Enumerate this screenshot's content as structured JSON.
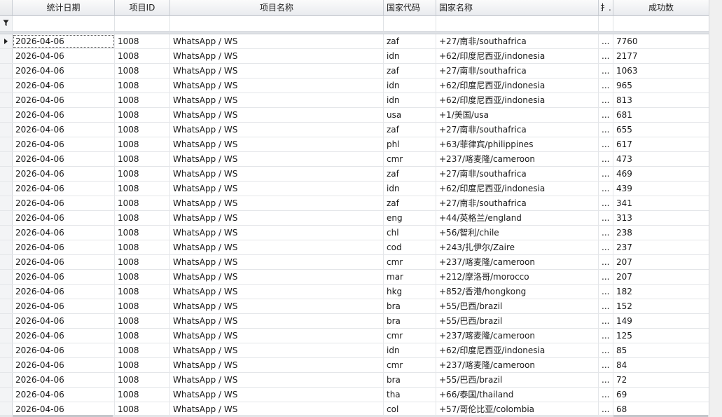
{
  "columns": {
    "date": "统计日期",
    "project_id": "项目ID",
    "project_name": "项目名称",
    "country_code": "国家代码",
    "country_name": "国家名称",
    "truncated": "扌.",
    "success_count": "成功数"
  },
  "icons": {
    "filter": "funnel-filter-icon",
    "row_indicator": "current-row-arrow-icon"
  },
  "rows": [
    {
      "date": "2026-04-06",
      "project_id": "1008",
      "project_name": "WhatsApp / WS",
      "country_code": "zaf",
      "country_name": "+27/南非/southafrica",
      "truncated": "...",
      "success_count": "7760"
    },
    {
      "date": "2026-04-06",
      "project_id": "1008",
      "project_name": "WhatsApp / WS",
      "country_code": "idn",
      "country_name": "+62/印度尼西亚/indonesia",
      "truncated": "...",
      "success_count": "2177"
    },
    {
      "date": "2026-04-06",
      "project_id": "1008",
      "project_name": "WhatsApp / WS",
      "country_code": "zaf",
      "country_name": "+27/南非/southafrica",
      "truncated": "...",
      "success_count": "1063"
    },
    {
      "date": "2026-04-06",
      "project_id": "1008",
      "project_name": "WhatsApp / WS",
      "country_code": "idn",
      "country_name": "+62/印度尼西亚/indonesia",
      "truncated": "...",
      "success_count": "965"
    },
    {
      "date": "2026-04-06",
      "project_id": "1008",
      "project_name": "WhatsApp / WS",
      "country_code": "idn",
      "country_name": "+62/印度尼西亚/indonesia",
      "truncated": "...",
      "success_count": "813"
    },
    {
      "date": "2026-04-06",
      "project_id": "1008",
      "project_name": "WhatsApp / WS",
      "country_code": "usa",
      "country_name": "+1/美国/usa",
      "truncated": "...",
      "success_count": "681"
    },
    {
      "date": "2026-04-06",
      "project_id": "1008",
      "project_name": "WhatsApp / WS",
      "country_code": "zaf",
      "country_name": "+27/南非/southafrica",
      "truncated": "...",
      "success_count": "655"
    },
    {
      "date": "2026-04-06",
      "project_id": "1008",
      "project_name": "WhatsApp / WS",
      "country_code": "phl",
      "country_name": "+63/菲律宾/philippines",
      "truncated": "...",
      "success_count": "617"
    },
    {
      "date": "2026-04-06",
      "project_id": "1008",
      "project_name": "WhatsApp / WS",
      "country_code": "cmr",
      "country_name": "+237/喀麦隆/cameroon",
      "truncated": "...",
      "success_count": "473"
    },
    {
      "date": "2026-04-06",
      "project_id": "1008",
      "project_name": "WhatsApp / WS",
      "country_code": "zaf",
      "country_name": "+27/南非/southafrica",
      "truncated": "...",
      "success_count": "469"
    },
    {
      "date": "2026-04-06",
      "project_id": "1008",
      "project_name": "WhatsApp / WS",
      "country_code": "idn",
      "country_name": "+62/印度尼西亚/indonesia",
      "truncated": "...",
      "success_count": "439"
    },
    {
      "date": "2026-04-06",
      "project_id": "1008",
      "project_name": "WhatsApp / WS",
      "country_code": "zaf",
      "country_name": "+27/南非/southafrica",
      "truncated": "...",
      "success_count": "341"
    },
    {
      "date": "2026-04-06",
      "project_id": "1008",
      "project_name": "WhatsApp / WS",
      "country_code": "eng",
      "country_name": "+44/英格兰/england",
      "truncated": "...",
      "success_count": "313"
    },
    {
      "date": "2026-04-06",
      "project_id": "1008",
      "project_name": "WhatsApp / WS",
      "country_code": "chl",
      "country_name": "+56/智利/chile",
      "truncated": "...",
      "success_count": "238"
    },
    {
      "date": "2026-04-06",
      "project_id": "1008",
      "project_name": "WhatsApp / WS",
      "country_code": "cod",
      "country_name": "+243/扎伊尔/Zaire",
      "truncated": "...",
      "success_count": "237"
    },
    {
      "date": "2026-04-06",
      "project_id": "1008",
      "project_name": "WhatsApp / WS",
      "country_code": "cmr",
      "country_name": "+237/喀麦隆/cameroon",
      "truncated": "...",
      "success_count": "207"
    },
    {
      "date": "2026-04-06",
      "project_id": "1008",
      "project_name": "WhatsApp / WS",
      "country_code": "mar",
      "country_name": "+212/摩洛哥/morocco",
      "truncated": "...",
      "success_count": "207"
    },
    {
      "date": "2026-04-06",
      "project_id": "1008",
      "project_name": "WhatsApp / WS",
      "country_code": "hkg",
      "country_name": "+852/香港/hongkong",
      "truncated": "...",
      "success_count": "182"
    },
    {
      "date": "2026-04-06",
      "project_id": "1008",
      "project_name": "WhatsApp / WS",
      "country_code": "bra",
      "country_name": "+55/巴西/brazil",
      "truncated": "...",
      "success_count": "152"
    },
    {
      "date": "2026-04-06",
      "project_id": "1008",
      "project_name": "WhatsApp / WS",
      "country_code": "bra",
      "country_name": "+55/巴西/brazil",
      "truncated": "...",
      "success_count": "149"
    },
    {
      "date": "2026-04-06",
      "project_id": "1008",
      "project_name": "WhatsApp / WS",
      "country_code": "cmr",
      "country_name": "+237/喀麦隆/cameroon",
      "truncated": "...",
      "success_count": "125"
    },
    {
      "date": "2026-04-06",
      "project_id": "1008",
      "project_name": "WhatsApp / WS",
      "country_code": "idn",
      "country_name": "+62/印度尼西亚/indonesia",
      "truncated": "...",
      "success_count": "85"
    },
    {
      "date": "2026-04-06",
      "project_id": "1008",
      "project_name": "WhatsApp / WS",
      "country_code": "cmr",
      "country_name": "+237/喀麦隆/cameroon",
      "truncated": "...",
      "success_count": "84"
    },
    {
      "date": "2026-04-06",
      "project_id": "1008",
      "project_name": "WhatsApp / WS",
      "country_code": "bra",
      "country_name": "+55/巴西/brazil",
      "truncated": "...",
      "success_count": "72"
    },
    {
      "date": "2026-04-06",
      "project_id": "1008",
      "project_name": "WhatsApp / WS",
      "country_code": "tha",
      "country_name": "+66/泰国/thailand",
      "truncated": "...",
      "success_count": "69"
    },
    {
      "date": "2026-04-06",
      "project_id": "1008",
      "project_name": "WhatsApp / WS",
      "country_code": "col",
      "country_name": "+57/哥伦比亚/colombia",
      "truncated": "...",
      "success_count": "68"
    }
  ]
}
